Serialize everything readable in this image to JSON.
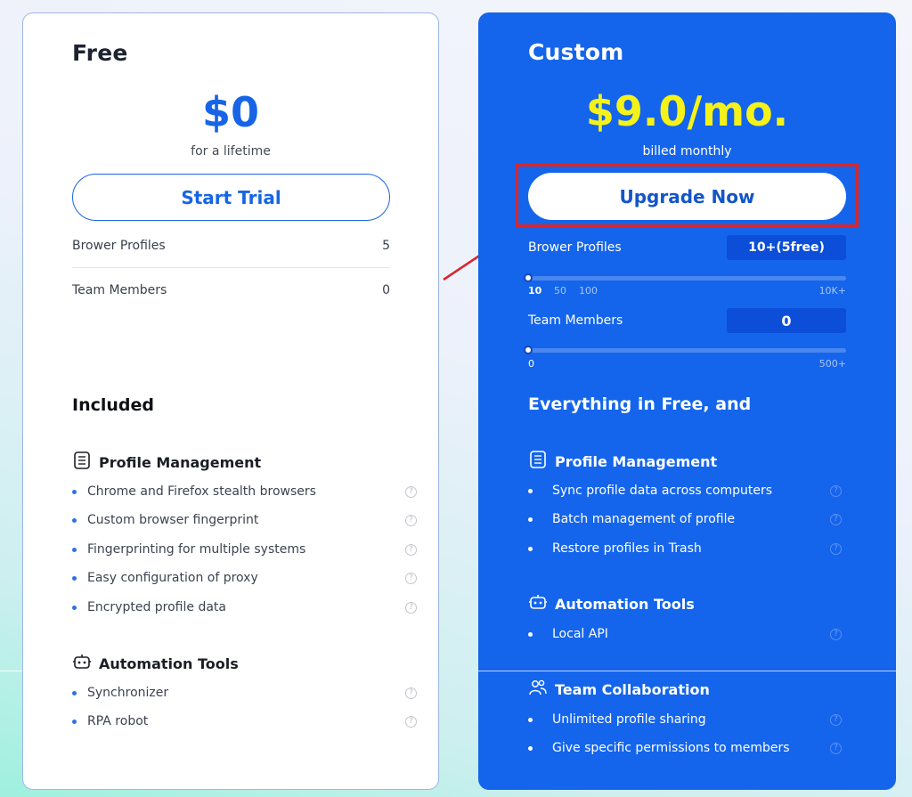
{
  "free": {
    "title": "Free",
    "price": "$0",
    "price_sub": "for a lifetime",
    "button_label": "Start Trial",
    "rows": [
      {
        "label": "Brower Profiles",
        "value": "5"
      },
      {
        "label": "Team Members",
        "value": "0"
      }
    ],
    "included_title": "Included",
    "groups": [
      {
        "title": "Profile Management",
        "icon": "document-icon",
        "items": [
          "Chrome and Firefox stealth browsers",
          "Custom browser fingerprint",
          "Fingerprinting for multiple systems",
          "Easy configuration of proxy",
          "Encrypted profile data"
        ]
      },
      {
        "title": "Automation Tools",
        "icon": "robot-icon",
        "items": [
          "Synchronizer",
          "RPA robot"
        ]
      }
    ]
  },
  "custom": {
    "title": "Custom",
    "price": "$9.0/mo.",
    "price_sub": "billed monthly",
    "button_label": "Upgrade Now",
    "profiles": {
      "label": "Brower Profiles",
      "value": "10+(5free)",
      "slider_ticks": [
        "10",
        "50",
        "100",
        "10K+"
      ],
      "slider_value": 0
    },
    "members": {
      "label": "Team Members",
      "value": "0",
      "slider_ticks": [
        "0",
        "500+"
      ],
      "slider_value": 0
    },
    "everything_title": "Everything in Free, and",
    "groups": [
      {
        "title": "Profile Management",
        "icon": "document-icon",
        "items": [
          "Sync profile data across computers",
          "Batch management of profile",
          "Restore profiles in Trash"
        ]
      },
      {
        "title": "Automation Tools",
        "icon": "robot-icon",
        "items": [
          "Local API"
        ]
      },
      {
        "title": "Team Collaboration",
        "icon": "team-icon",
        "items": [
          "Unlimited profile sharing",
          "Give specific permissions to members"
        ]
      }
    ]
  },
  "colors": {
    "brand_blue": "#1465ec",
    "price_yellow": "#f5f21a",
    "highlight_red": "#d7262b"
  },
  "qmark": "?"
}
